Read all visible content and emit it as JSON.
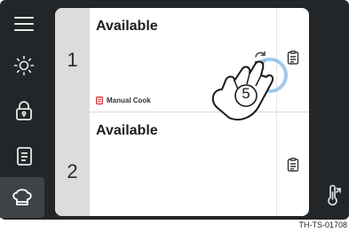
{
  "sidebar": {
    "items": [
      {
        "icon": "menu-icon"
      },
      {
        "icon": "brightness-icon"
      },
      {
        "icon": "lock-icon"
      },
      {
        "icon": "recipe-book-icon"
      },
      {
        "icon": "chef-hat-icon",
        "active": true
      }
    ]
  },
  "slots": [
    {
      "number": "1",
      "status": "Available",
      "mode": "Manual Cook"
    },
    {
      "number": "2",
      "status": "Available"
    }
  ],
  "gesture": {
    "step": "5",
    "icon": "tap-hand-icon"
  },
  "footer": {
    "code": "TH-TS-01708"
  },
  "colors": {
    "frame": "#222628",
    "accent_red": "#d6312f",
    "tap_ring": "#8fbfe6"
  }
}
